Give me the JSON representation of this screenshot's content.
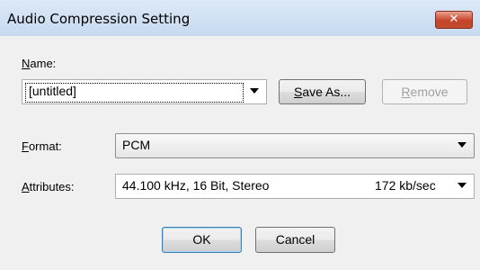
{
  "window": {
    "title": "Audio Compression Setting",
    "close_glyph": "✕"
  },
  "name": {
    "label_ul": "N",
    "label_rest": "ame:",
    "value": "[untitled]",
    "save_as_ul": "S",
    "save_as_rest": "ave As...",
    "remove_ul": "R",
    "remove_rest": "emove"
  },
  "format": {
    "label_ul": "F",
    "label_rest": "ormat:",
    "value": "PCM"
  },
  "attributes": {
    "label_ul": "A",
    "label_rest": "ttributes:",
    "value": "44.100 kHz, 16 Bit, Stereo",
    "rate": "172 kb/sec"
  },
  "buttons": {
    "ok": "OK",
    "cancel": "Cancel"
  },
  "colors": {
    "title_bar": "#c6d9ef",
    "close_button": "#c5442a",
    "dialog_bg": "#f0f0f0"
  },
  "icons": [
    "close-icon",
    "chevron-down-icon"
  ]
}
